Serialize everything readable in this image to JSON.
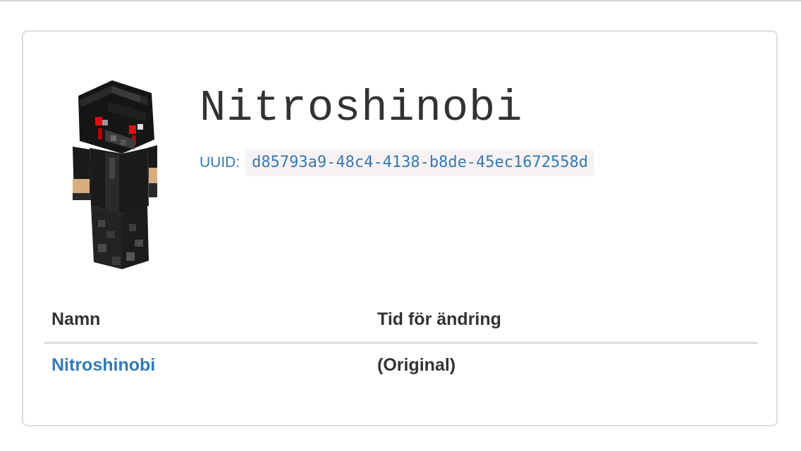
{
  "profile": {
    "name": "Nitroshinobi",
    "uuid_label": "UUID:",
    "uuid": "d85793a9-48c4-4138-b8de-45ec1672558d"
  },
  "history_table": {
    "headers": [
      "Namn",
      "Tid för ändring"
    ],
    "rows": [
      {
        "name": "Nitroshinobi",
        "changed_at": "(Original)"
      }
    ]
  },
  "colors": {
    "link": "#337ab7",
    "text": "#333333",
    "border": "#dddddd",
    "code_bg": "#f9f2f4"
  },
  "icons": {
    "avatar": "minecraft-skin-render-icon"
  }
}
